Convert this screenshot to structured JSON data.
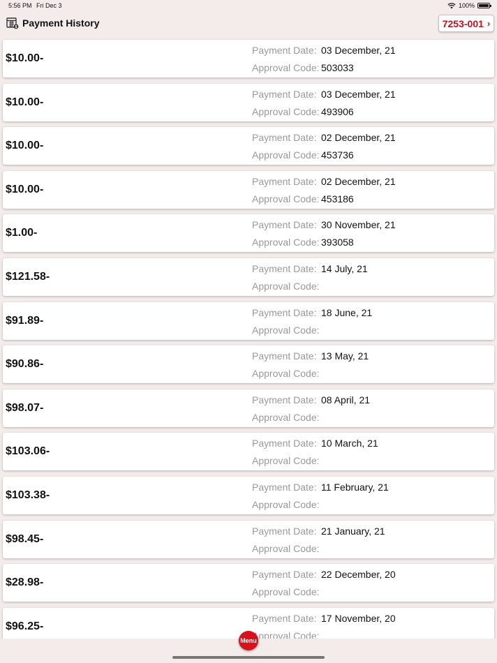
{
  "status_bar": {
    "time": "5:56 PM",
    "date": "Fri Dec 3",
    "battery": "100%"
  },
  "header": {
    "title": "Payment History",
    "account": "7253-001"
  },
  "labels": {
    "payment_date": "Payment Date:",
    "approval_code": "Approval Code:"
  },
  "payments": [
    {
      "amount": "$10.00-",
      "date": "03 December, 21",
      "approval": "503033"
    },
    {
      "amount": "$10.00-",
      "date": "03 December, 21",
      "approval": "493906"
    },
    {
      "amount": "$10.00-",
      "date": "02 December, 21",
      "approval": "453736"
    },
    {
      "amount": "$10.00-",
      "date": "02 December, 21",
      "approval": "453186"
    },
    {
      "amount": "$1.00-",
      "date": "30 November, 21",
      "approval": "393058"
    },
    {
      "amount": "$121.58-",
      "date": "14 July, 21",
      "approval": ""
    },
    {
      "amount": "$91.89-",
      "date": "18 June, 21",
      "approval": ""
    },
    {
      "amount": "$90.86-",
      "date": "13 May, 21",
      "approval": ""
    },
    {
      "amount": "$98.07-",
      "date": "08 April, 21",
      "approval": ""
    },
    {
      "amount": "$103.06-",
      "date": "10 March, 21",
      "approval": ""
    },
    {
      "amount": "$103.38-",
      "date": "11 February, 21",
      "approval": ""
    },
    {
      "amount": "$98.45-",
      "date": "21 January, 21",
      "approval": ""
    },
    {
      "amount": "$28.98-",
      "date": "22 December, 20",
      "approval": ""
    },
    {
      "amount": "$96.25-",
      "date": "17 November, 20",
      "approval": ""
    }
  ],
  "menu_label": "Menu",
  "icons": {
    "wifi": "wifi-icon",
    "battery": "battery-icon",
    "calendar": "calendar-icon",
    "chevron": "chevron-right-icon"
  },
  "colors": {
    "accent": "#c0151c",
    "menu": "#d6121f",
    "background": "#f3ecea"
  }
}
